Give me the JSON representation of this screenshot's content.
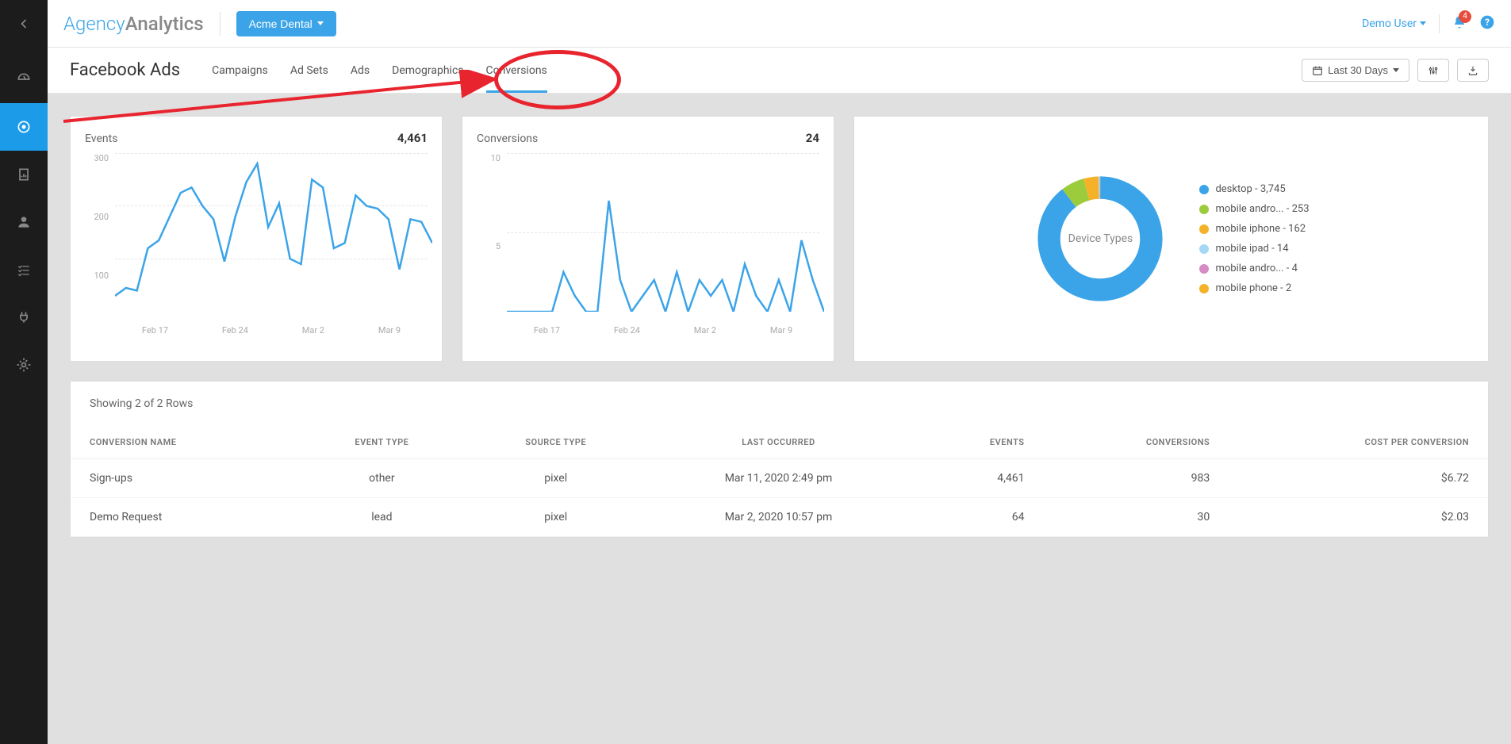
{
  "brand": {
    "part1": "Agency",
    "part2": "Analytics"
  },
  "client_selector": {
    "label": "Acme Dental"
  },
  "user": {
    "name": "Demo User"
  },
  "notifications": {
    "count": "4"
  },
  "page_title": "Facebook Ads",
  "tabs": [
    "Campaigns",
    "Ad Sets",
    "Ads",
    "Demographics",
    "Conversions"
  ],
  "active_tab_index": 4,
  "date_range": {
    "label": "Last 30 Days"
  },
  "sidebar_icons": [
    "back",
    "dashboard",
    "target",
    "report",
    "user",
    "checklist",
    "plug",
    "gear"
  ],
  "active_sidebar_index": 2,
  "cards": {
    "events": {
      "title": "Events",
      "value": "4,461",
      "y_ticks": [
        "300",
        "200",
        "100"
      ],
      "x_ticks": [
        "Feb 17",
        "Feb 24",
        "Mar 2",
        "Mar 9"
      ]
    },
    "conversions": {
      "title": "Conversions",
      "value": "24",
      "y_ticks": [
        "10",
        "5"
      ],
      "x_ticks": [
        "Feb 17",
        "Feb 24",
        "Mar 2",
        "Mar 9"
      ]
    },
    "devices": {
      "center_label": "Device Types",
      "legend": [
        {
          "label": "desktop - 3,745",
          "color": "#3ba4e8"
        },
        {
          "label": "mobile andro... - 253",
          "color": "#9ccc3c"
        },
        {
          "label": "mobile iphone - 162",
          "color": "#f5b229"
        },
        {
          "label": "mobile ipad - 14",
          "color": "#a6d8f5"
        },
        {
          "label": "mobile andro... - 4",
          "color": "#d68bc5"
        },
        {
          "label": "mobile phone - 2",
          "color": "#f5b229"
        }
      ]
    }
  },
  "table": {
    "caption": "Showing 2 of 2 Rows",
    "columns": [
      "CONVERSION NAME",
      "EVENT TYPE",
      "SOURCE TYPE",
      "LAST OCCURRED",
      "EVENTS",
      "CONVERSIONS",
      "COST PER CONVERSION"
    ],
    "rows": [
      {
        "name": "Sign-ups",
        "event_type": "other",
        "source_type": "pixel",
        "last_occurred": "Mar 11, 2020 2:49 pm",
        "events": "4,461",
        "conversions": "983",
        "cost": "$6.72"
      },
      {
        "name": "Demo Request",
        "event_type": "lead",
        "source_type": "pixel",
        "last_occurred": "Mar 2, 2020 10:57 pm",
        "events": "64",
        "conversions": "30",
        "cost": "$2.03"
      }
    ]
  },
  "chart_data": [
    {
      "type": "line",
      "title": "Events",
      "x_tick_labels": [
        "Feb 17",
        "Feb 24",
        "Mar 2",
        "Mar 9"
      ],
      "ylim": [
        0,
        300
      ],
      "values": [
        30,
        45,
        40,
        120,
        135,
        180,
        225,
        235,
        200,
        175,
        95,
        180,
        245,
        280,
        160,
        205,
        100,
        90,
        250,
        235,
        120,
        130,
        220,
        200,
        195,
        175,
        80,
        175,
        170,
        130
      ]
    },
    {
      "type": "line",
      "title": "Conversions",
      "x_tick_labels": [
        "Feb 17",
        "Feb 24",
        "Mar 2",
        "Mar 9"
      ],
      "ylim": [
        0,
        10
      ],
      "values": [
        0,
        0,
        0,
        0,
        0,
        2.5,
        1,
        0,
        0,
        7,
        2,
        0,
        1,
        2,
        0,
        2.5,
        0,
        2,
        1,
        2,
        0,
        3,
        1,
        0,
        2,
        0,
        4.5,
        2,
        0
      ]
    },
    {
      "type": "pie",
      "title": "Device Types",
      "series": [
        {
          "name": "desktop",
          "value": 3745,
          "color": "#3ba4e8"
        },
        {
          "name": "mobile android",
          "value": 253,
          "color": "#9ccc3c"
        },
        {
          "name": "mobile iphone",
          "value": 162,
          "color": "#f5b229"
        },
        {
          "name": "mobile ipad",
          "value": 14,
          "color": "#a6d8f5"
        },
        {
          "name": "mobile android 2",
          "value": 4,
          "color": "#d68bc5"
        },
        {
          "name": "mobile phone",
          "value": 2,
          "color": "#f5b229"
        }
      ]
    }
  ]
}
